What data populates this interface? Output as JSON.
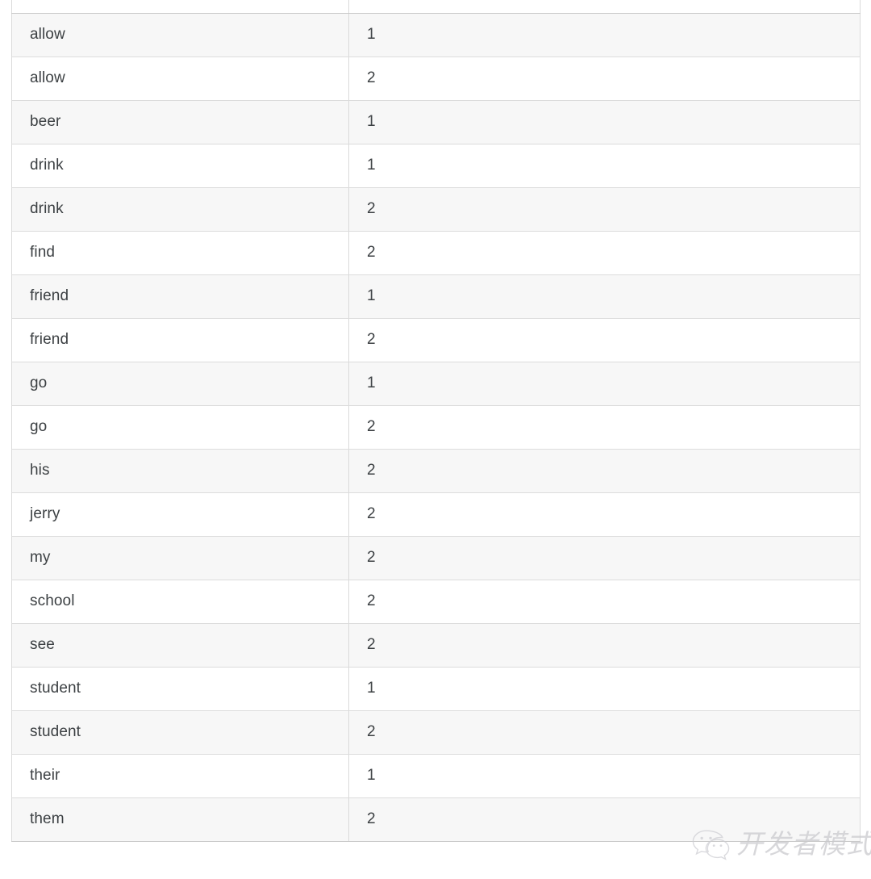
{
  "table": {
    "columns": [
      {
        "key": "word",
        "header": ""
      },
      {
        "key": "count",
        "header": ""
      }
    ],
    "rows": [
      {
        "word": "allow",
        "count": "1"
      },
      {
        "word": "allow",
        "count": "2"
      },
      {
        "word": "beer",
        "count": "1"
      },
      {
        "word": "drink",
        "count": "1"
      },
      {
        "word": "drink",
        "count": "2"
      },
      {
        "word": "find",
        "count": "2"
      },
      {
        "word": "friend",
        "count": "1"
      },
      {
        "word": "friend",
        "count": "2"
      },
      {
        "word": "go",
        "count": "1"
      },
      {
        "word": "go",
        "count": "2"
      },
      {
        "word": "his",
        "count": "2"
      },
      {
        "word": "jerry",
        "count": "2"
      },
      {
        "word": "my",
        "count": "2"
      },
      {
        "word": "school",
        "count": "2"
      },
      {
        "word": "see",
        "count": "2"
      },
      {
        "word": "student",
        "count": "1"
      },
      {
        "word": "student",
        "count": "2"
      },
      {
        "word": "their",
        "count": "1"
      },
      {
        "word": "them",
        "count": "2"
      }
    ]
  },
  "watermark": {
    "text": "开发者模式",
    "logo_icon": "wechat-icon",
    "color": "#c9c9cd"
  },
  "colors": {
    "row_stripe": "#f7f7f7",
    "row_plain": "#ffffff",
    "border": "#dcdcdc",
    "text": "#3c4043",
    "background": "#ffffff"
  }
}
